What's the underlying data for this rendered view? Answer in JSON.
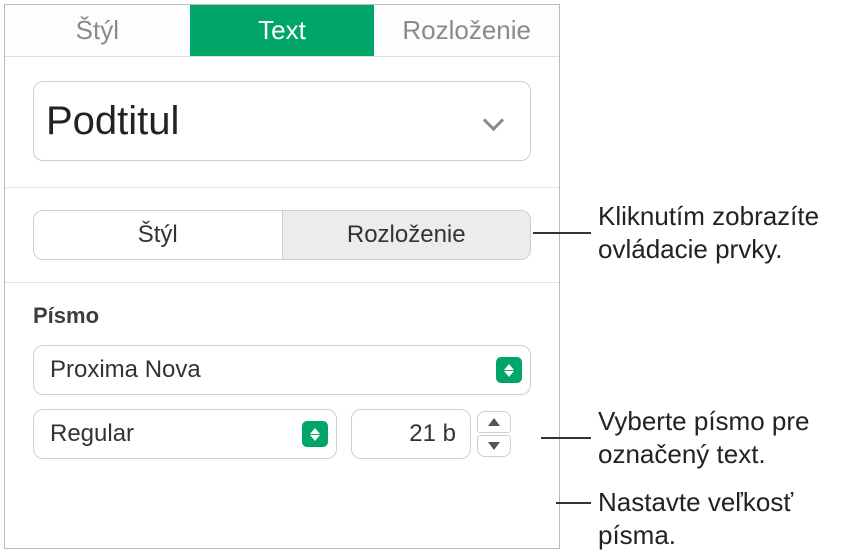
{
  "mainTabs": {
    "style": "Štýl",
    "text": "Text",
    "layout": "Rozloženie"
  },
  "paragraphStyle": {
    "value": "Podtitul"
  },
  "subTabs": {
    "style": "Štýl",
    "layout": "Rozloženie"
  },
  "font": {
    "sectionTitle": "Písmo",
    "family": "Proxima Nova",
    "weight": "Regular",
    "size": "21 b"
  },
  "callouts": {
    "controls": "Kliknutím zobrazíte ovládacie prvky.",
    "pickFont": "Vyberte písmo pre označený text.",
    "setSize": "Nastavte veľkosť písma."
  }
}
